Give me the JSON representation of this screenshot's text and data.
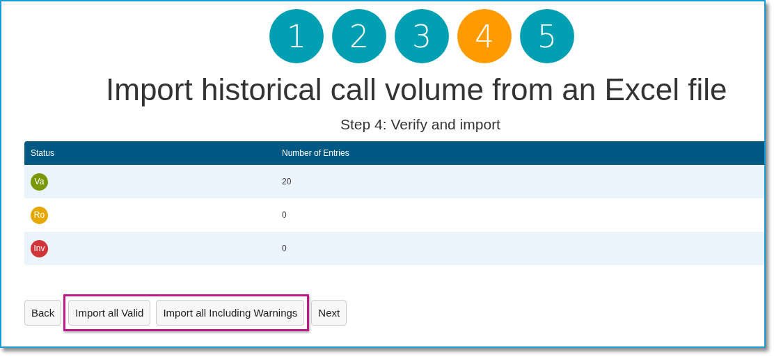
{
  "steps": [
    {
      "label": "1",
      "selected": false
    },
    {
      "label": "2",
      "selected": false
    },
    {
      "label": "3",
      "selected": false
    },
    {
      "label": "4",
      "selected": true
    },
    {
      "label": "5",
      "selected": false
    }
  ],
  "title": "Import historical call volume from an Excel file",
  "subtitle": "Step 4: Verify and import",
  "table": {
    "columns": [
      "Status",
      "Number of Entries"
    ],
    "rows": [
      {
        "status": "Va",
        "color": "#789904",
        "count": "20"
      },
      {
        "status": "Ro",
        "color": "#e5a800",
        "count": "0"
      },
      {
        "status": "Inv",
        "color": "#d13438",
        "count": "0"
      }
    ]
  },
  "button_bar": [
    {
      "kind": "button",
      "label": "Back"
    },
    {
      "kind": "highlight",
      "buttons": [
        "Import all Valid",
        "Import all Including Warnings"
      ]
    },
    {
      "kind": "button",
      "label": "Next"
    }
  ]
}
